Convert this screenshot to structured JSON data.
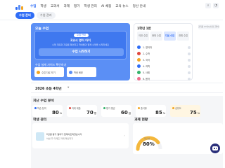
{
  "nav": {
    "items": [
      "수업",
      "학생",
      "교과서",
      "과제",
      "평가",
      "학생 관리",
      "AI 채점",
      "교육 뉴스",
      "정산 안내"
    ],
    "active": 0
  },
  "subtabs": [
    "수업 준비",
    "수업 관리"
  ],
  "today_lesson": {
    "title": "오늘 수업",
    "chip": "수업 안내",
    "heading": "2교시 영어 아이",
    "desc": "수업 계획과 자료를 확인하고 학생들과 함께 수업을 시작하세요",
    "start_button": "수업 시작하기",
    "second_title": "수업 설계 가이드 확인하기",
    "mini_cards": [
      "수업 자료 보기",
      "학생 배정"
    ]
  },
  "schedule": {
    "title": "1학년 1반",
    "tabs": [
      "이전 수업",
      "현재 수업",
      "다음 수업",
      "전체 수업"
    ],
    "active_tab": 2,
    "rows": [
      {
        "label": "1. 영어과",
        "color": "#2f6df6"
      },
      {
        "label": "2. 수학",
        "color": "#e0473e"
      },
      {
        "label": "3. 국어",
        "color": "#f4a623"
      },
      {
        "label": "4. 과학",
        "color": "#2f6df6"
      },
      {
        "label": "5. 사회",
        "color": "#35b36b"
      },
      {
        "label": "6. 음악",
        "color": "#f06b8b"
      }
    ]
  },
  "ad": {
    "label": "교육용 AI 어시스턴트 알아보기"
  },
  "class_selector": {
    "name": "2026 초등 4학년",
    "chevron": "▾"
  },
  "analysis": {
    "title": "지난 수업 분석",
    "stats": [
      {
        "label": "학습 참여",
        "value": "80",
        "unit": "%"
      },
      {
        "label": "과제 제출",
        "value": "70",
        "unit": "명"
      },
      {
        "label": "평가 평균",
        "value": "60",
        "unit": "점"
      },
      {
        "label": "출석률",
        "value": "85",
        "unit": "%"
      },
      {
        "label": "성취도",
        "value": "75",
        "unit": "%"
      }
    ]
  },
  "students": {
    "title": "학생 관리",
    "line1": "2단원 평가 결과가 업데이트되었습니다",
    "line2": "이번 주 미제출 과제 확인하기",
    "chevron": "›"
  },
  "progress": {
    "title": "과제 현황",
    "label": "제출률",
    "value": "80%",
    "fraction": 0.8
  },
  "colors": {
    "accent": "#2f6df6",
    "panel": "#5b8ff5",
    "progress": "#f4b73b"
  },
  "icons": [
    "search-icon",
    "bell-icon",
    "chevron-down-icon",
    "bot-icon"
  ]
}
